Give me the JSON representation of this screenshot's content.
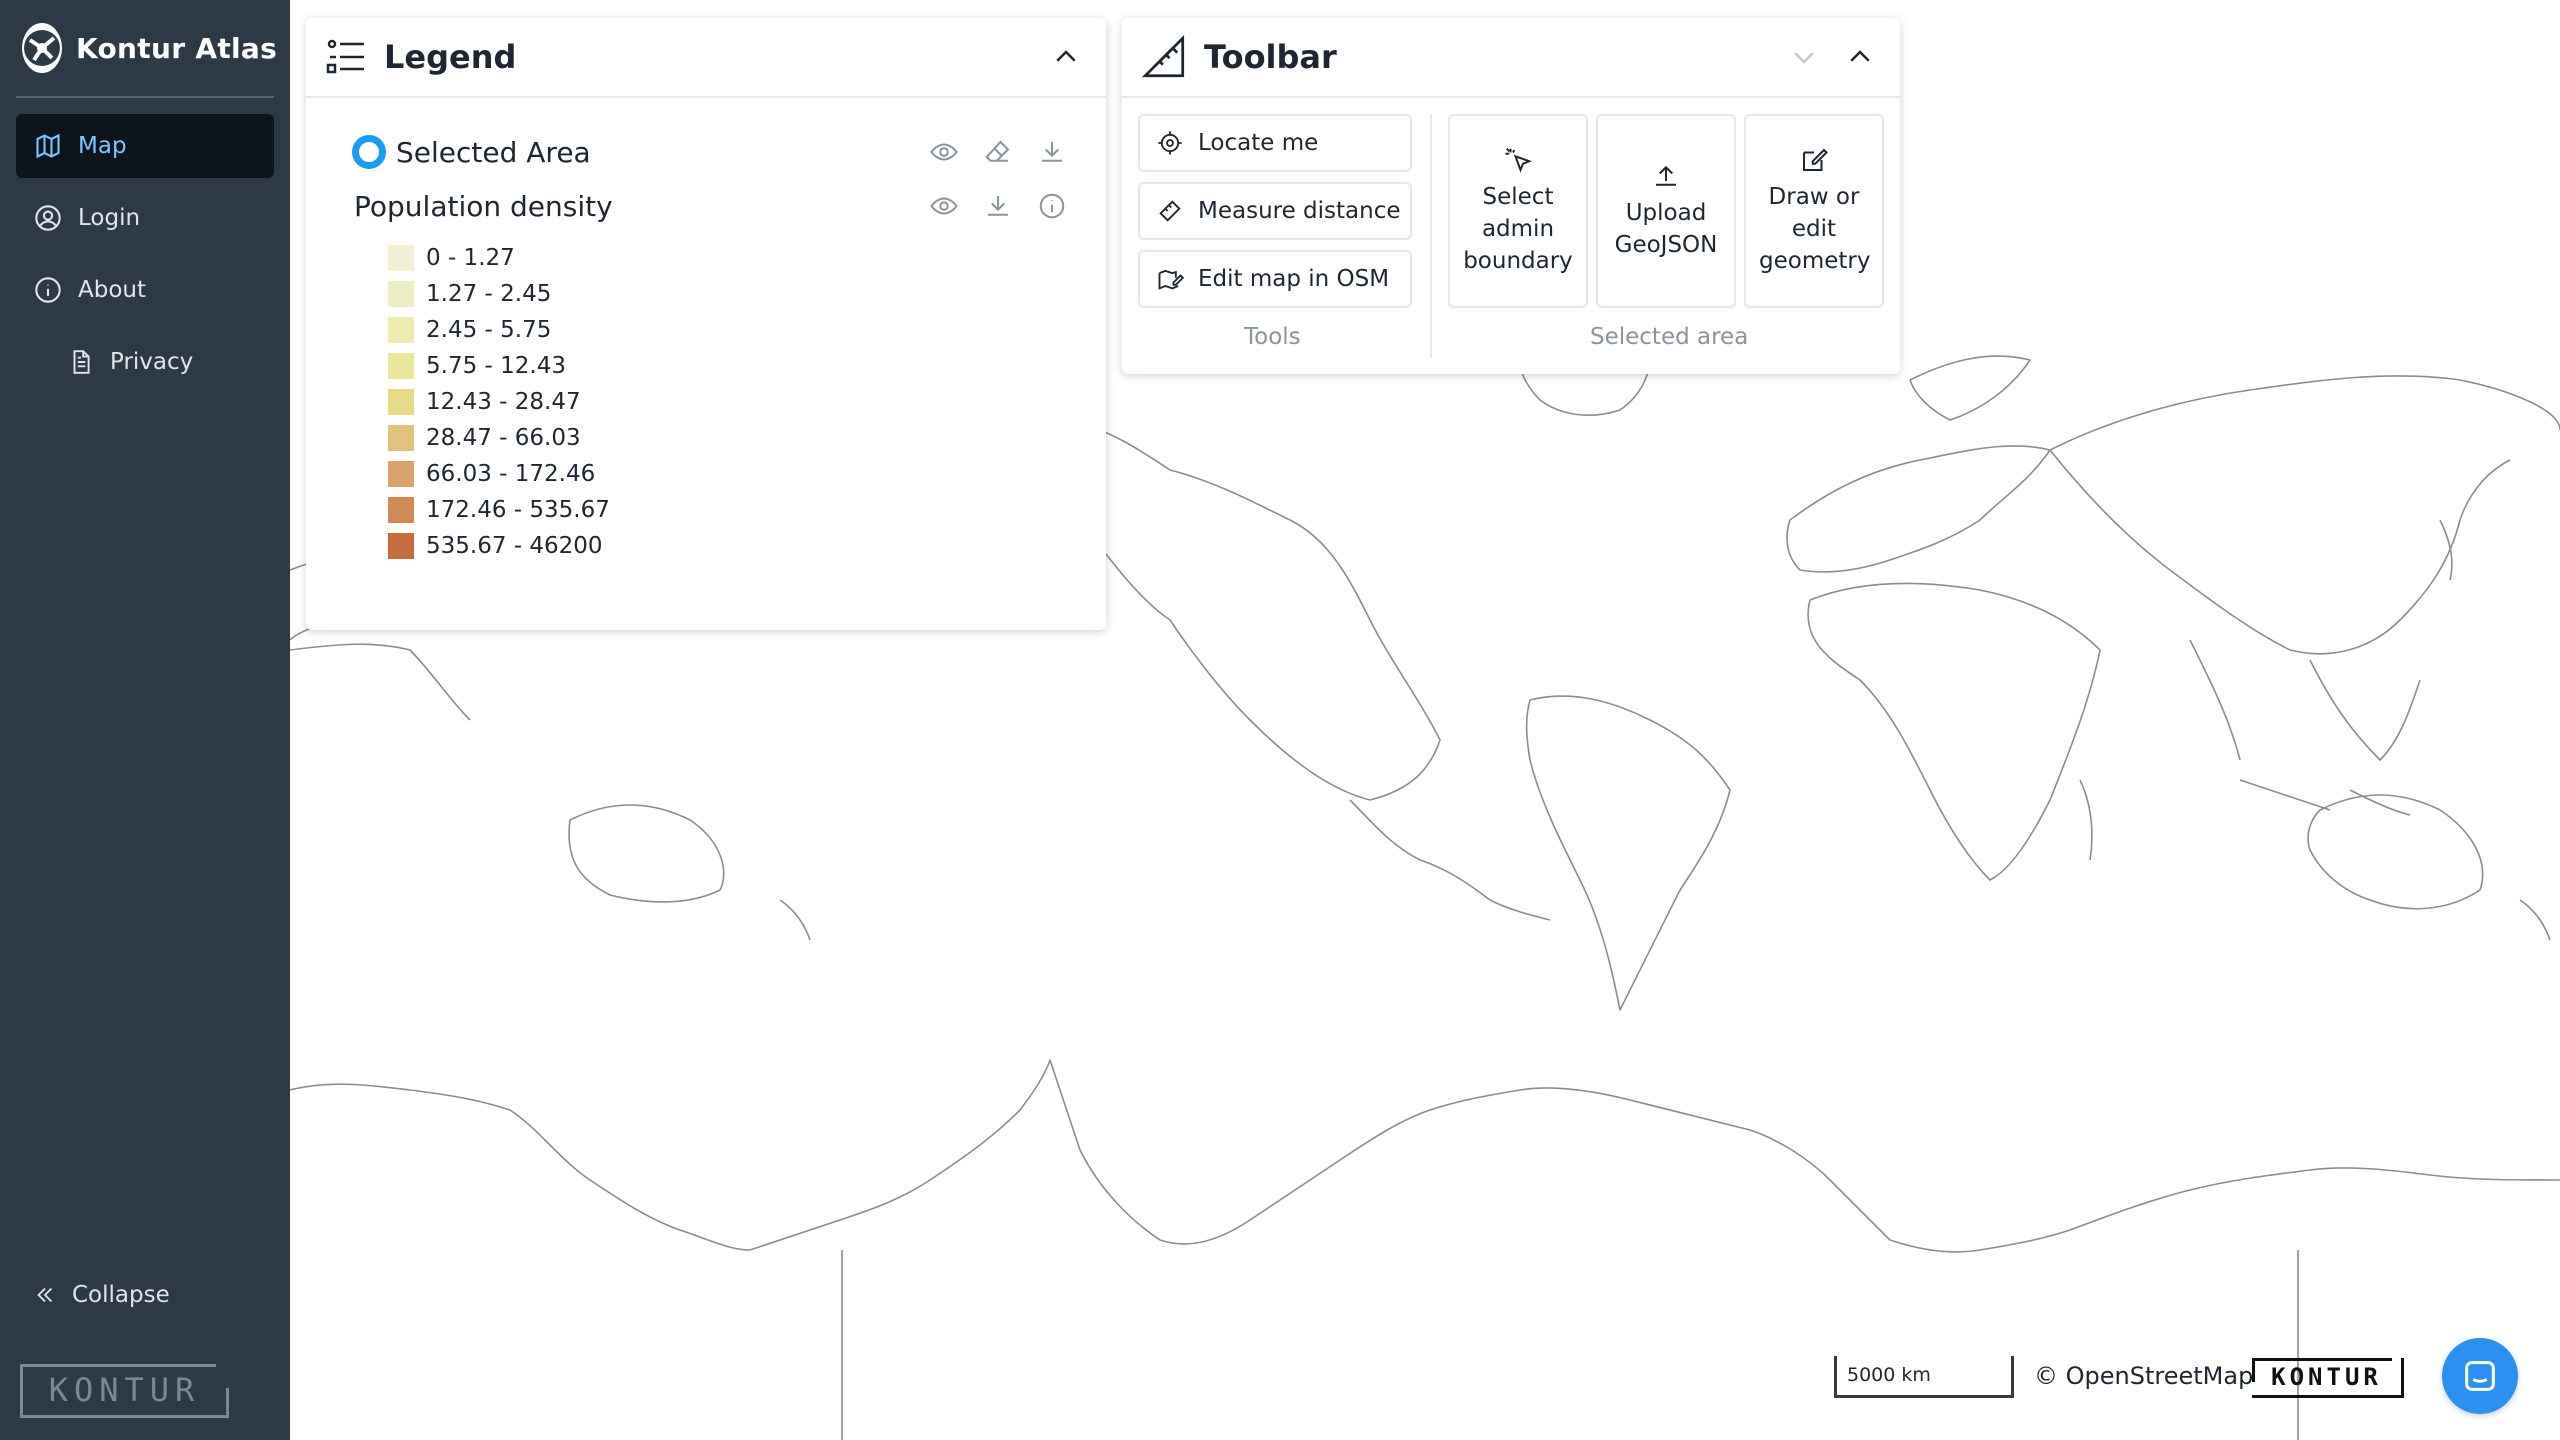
{
  "app": {
    "name": "Kontur Atlas"
  },
  "sidebar": {
    "items": [
      {
        "label": "Map",
        "icon": "map-icon",
        "active": true
      },
      {
        "label": "Login",
        "icon": "user-icon"
      },
      {
        "label": "About",
        "icon": "info-icon"
      },
      {
        "label": "Privacy",
        "icon": "document-icon"
      }
    ],
    "collapse_label": "Collapse",
    "footer_logo": "KONTUR"
  },
  "legend": {
    "title": "Legend",
    "selected_area": {
      "label": "Selected Area",
      "color": "#1b9cf2"
    },
    "layer": {
      "label": "Population density",
      "steps": [
        {
          "label": "0 - 1.27",
          "color": "#f2f1d5"
        },
        {
          "label": "1.27 - 2.45",
          "color": "#efefc6"
        },
        {
          "label": "2.45 - 5.75",
          "color": "#eeecb0"
        },
        {
          "label": "5.75 - 12.43",
          "color": "#ebe89c"
        },
        {
          "label": "12.43 - 28.47",
          "color": "#e6da88"
        },
        {
          "label": "28.47 - 66.03",
          "color": "#dfc27c"
        },
        {
          "label": "66.03 - 172.46",
          "color": "#d7a26b"
        },
        {
          "label": "172.46 - 535.67",
          "color": "#d08a57"
        },
        {
          "label": "535.67 - 46200",
          "color": "#c86c3f"
        }
      ]
    }
  },
  "toolbar": {
    "title": "Toolbar",
    "tools": [
      {
        "label": "Locate me",
        "icon": "locate-icon"
      },
      {
        "label": "Measure distance",
        "icon": "ruler-icon"
      },
      {
        "label": "Edit map in OSM",
        "icon": "edit-map-icon"
      }
    ],
    "tools_group_label": "Tools",
    "selected_area_actions": [
      {
        "label": "Select admin boundary",
        "icon": "cursor-click-icon"
      },
      {
        "label": "Upload GeoJSON",
        "icon": "upload-icon"
      },
      {
        "label": "Draw or edit geometry",
        "icon": "pencil-square-icon"
      }
    ],
    "selected_area_group_label": "Selected area"
  },
  "map": {
    "scale_label": "5000 km",
    "attribution": "© OpenStreetMap",
    "brand_mark": "KONTUR"
  }
}
